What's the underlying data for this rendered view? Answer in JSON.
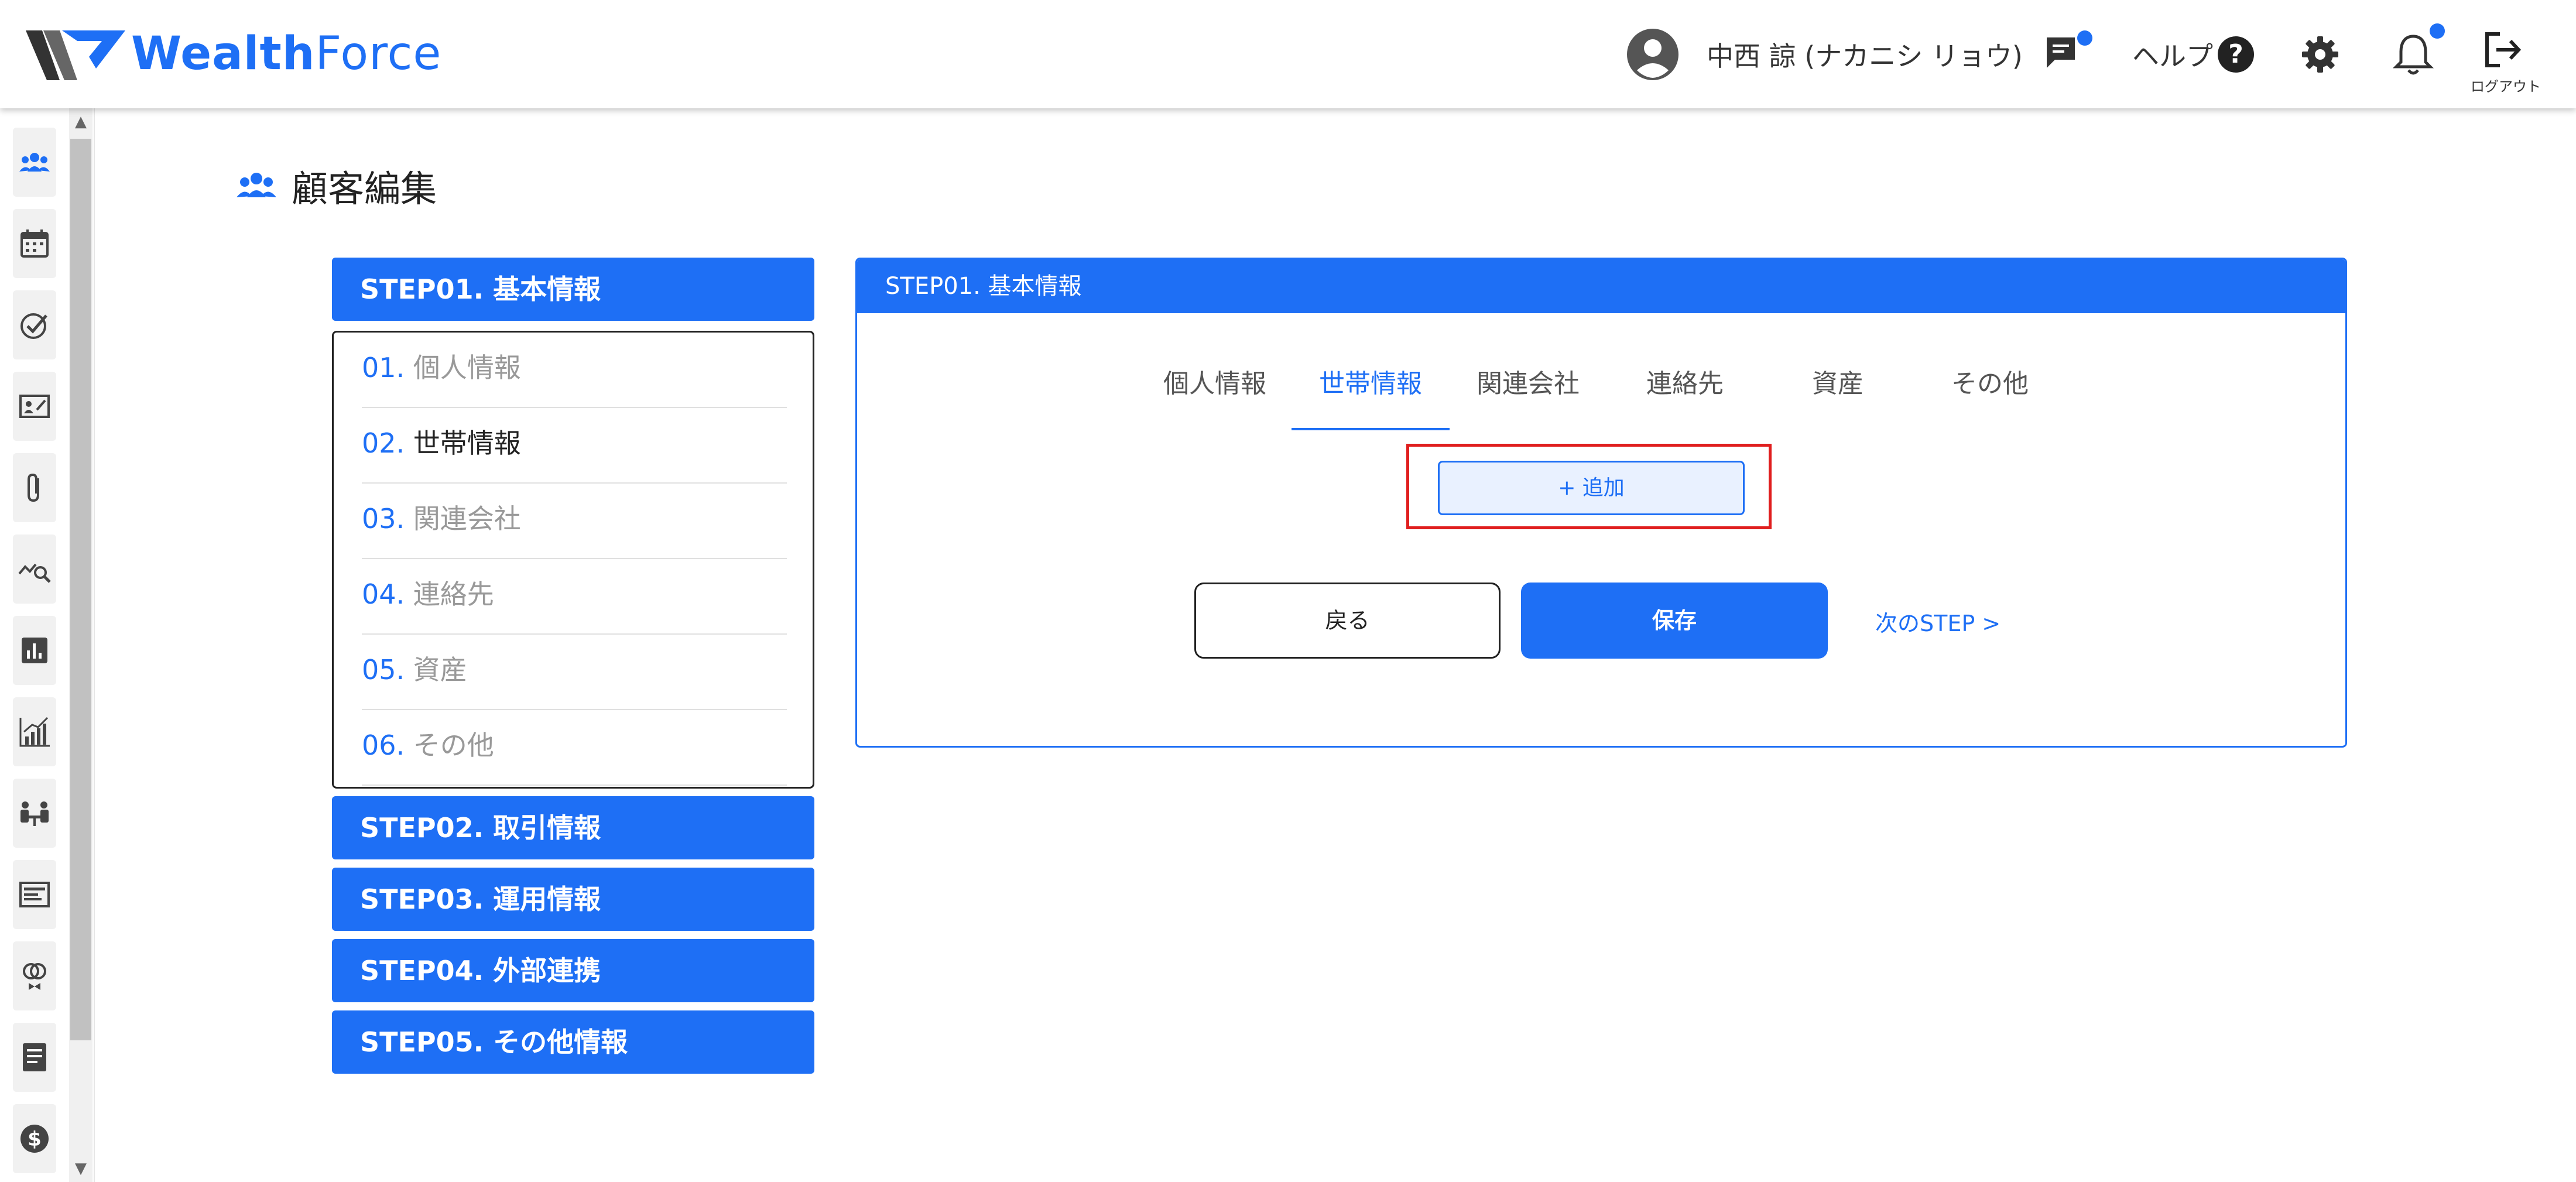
{
  "colors": {
    "accent": "#1e6ff5",
    "highlight": "#e01e1e",
    "notification_dot": "#1e6ff5"
  },
  "header": {
    "logo": {
      "wealth": "Wealth",
      "force": "Force"
    },
    "user_name": "中西 諒 (ナカニシ リョウ)",
    "help_label": "ヘルプ",
    "help_icon_glyph": "?",
    "logout_label": "ログアウト",
    "icons": [
      "user-avatar-icon",
      "chat-icon",
      "help-icon",
      "gear-icon",
      "bell-icon",
      "logout-icon"
    ]
  },
  "sidebar": {
    "items": [
      {
        "icon": "customers-icon"
      },
      {
        "icon": "calendar-icon"
      },
      {
        "icon": "check-circle-icon"
      },
      {
        "icon": "contact-card-icon"
      },
      {
        "icon": "paperclip-icon"
      },
      {
        "icon": "chart-search-icon"
      },
      {
        "icon": "bar-chart-icon"
      },
      {
        "icon": "growth-chart-icon"
      },
      {
        "icon": "meeting-icon"
      },
      {
        "icon": "article-icon"
      },
      {
        "icon": "rings-icon"
      },
      {
        "icon": "document-icon"
      },
      {
        "icon": "dollar-icon"
      }
    ]
  },
  "page": {
    "title": "顧客編集",
    "title_icon": "people-icon"
  },
  "steps": {
    "step01": "STEP01. 基本情報",
    "step02": "STEP02. 取引情報",
    "step03": "STEP03. 運用情報",
    "step04": "STEP04. 外部連携",
    "step05": "STEP05. その他情報",
    "substeps": [
      {
        "num": "01.",
        "label": "個人情報"
      },
      {
        "num": "02.",
        "label": "世帯情報"
      },
      {
        "num": "03.",
        "label": "関連会社"
      },
      {
        "num": "04.",
        "label": "連絡先"
      },
      {
        "num": "05.",
        "label": "資産"
      },
      {
        "num": "06.",
        "label": "その他"
      }
    ],
    "active_substep": "世帯情報"
  },
  "card": {
    "header": "STEP01. 基本情報",
    "tabs": [
      "個人情報",
      "世帯情報",
      "関連会社",
      "連絡先",
      "資産",
      "その他"
    ],
    "active_tab": "世帯情報",
    "add_button": "+ 追加",
    "back_button": "戻る",
    "save_button": "保存",
    "next_link": "次のSTEP >"
  }
}
